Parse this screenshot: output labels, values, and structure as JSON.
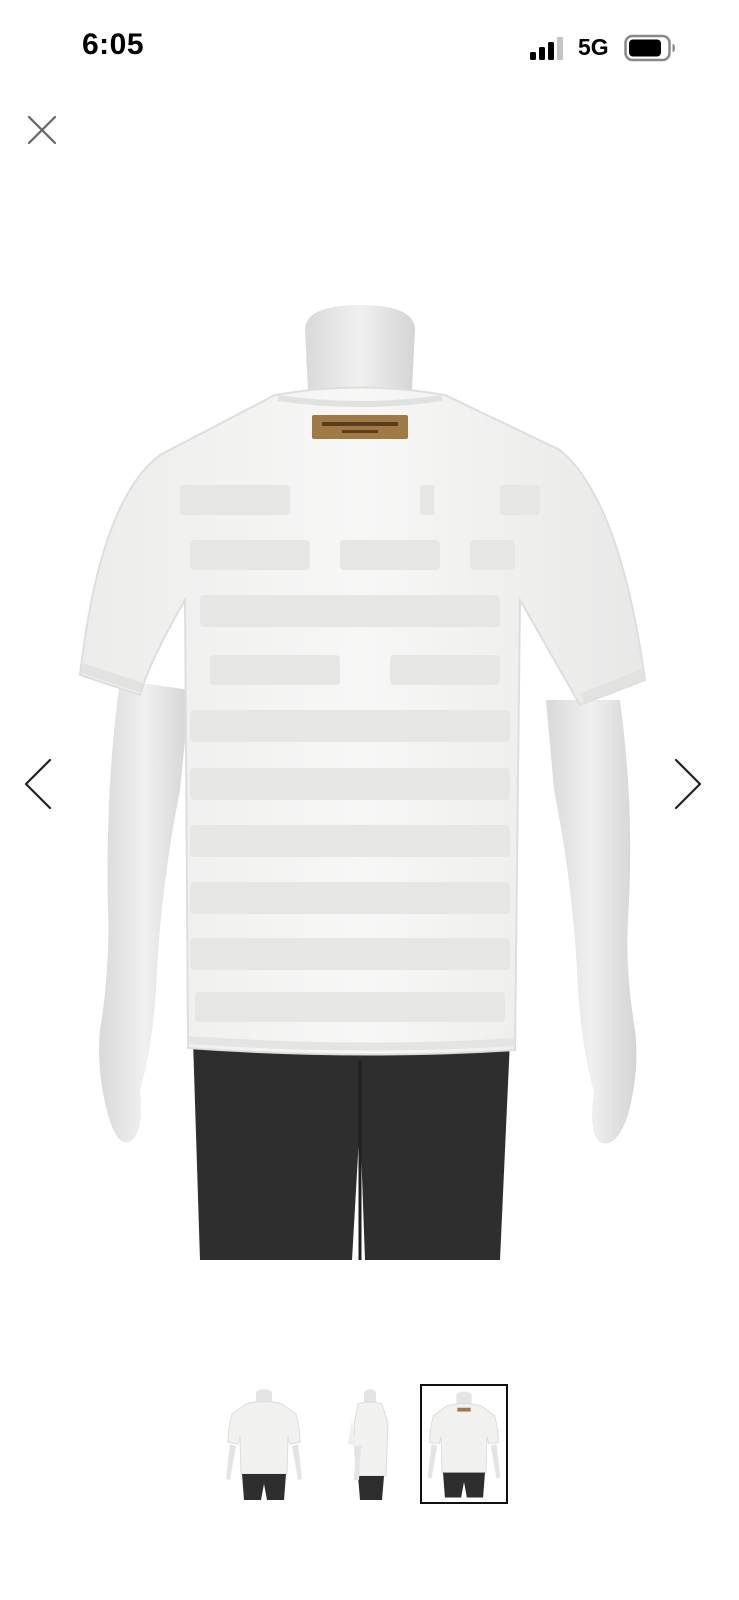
{
  "status_bar": {
    "time": "6:05",
    "network": "5G",
    "signal_icon": "cellular-signal-icon",
    "battery_icon": "battery-icon"
  },
  "viewer": {
    "close_icon": "close-icon",
    "prev_icon": "chevron-left-icon",
    "next_icon": "chevron-right-icon",
    "selected_thumbnail": 3,
    "thumbnails": [
      {
        "view": "front"
      },
      {
        "view": "side"
      },
      {
        "view": "back"
      }
    ]
  },
  "colors": {
    "background": "#ffffff",
    "shirt": "#f4f4f3",
    "pants": "#2e2e2e",
    "label_patch": "#a07a45",
    "mannequin": "#e9e9e9"
  }
}
